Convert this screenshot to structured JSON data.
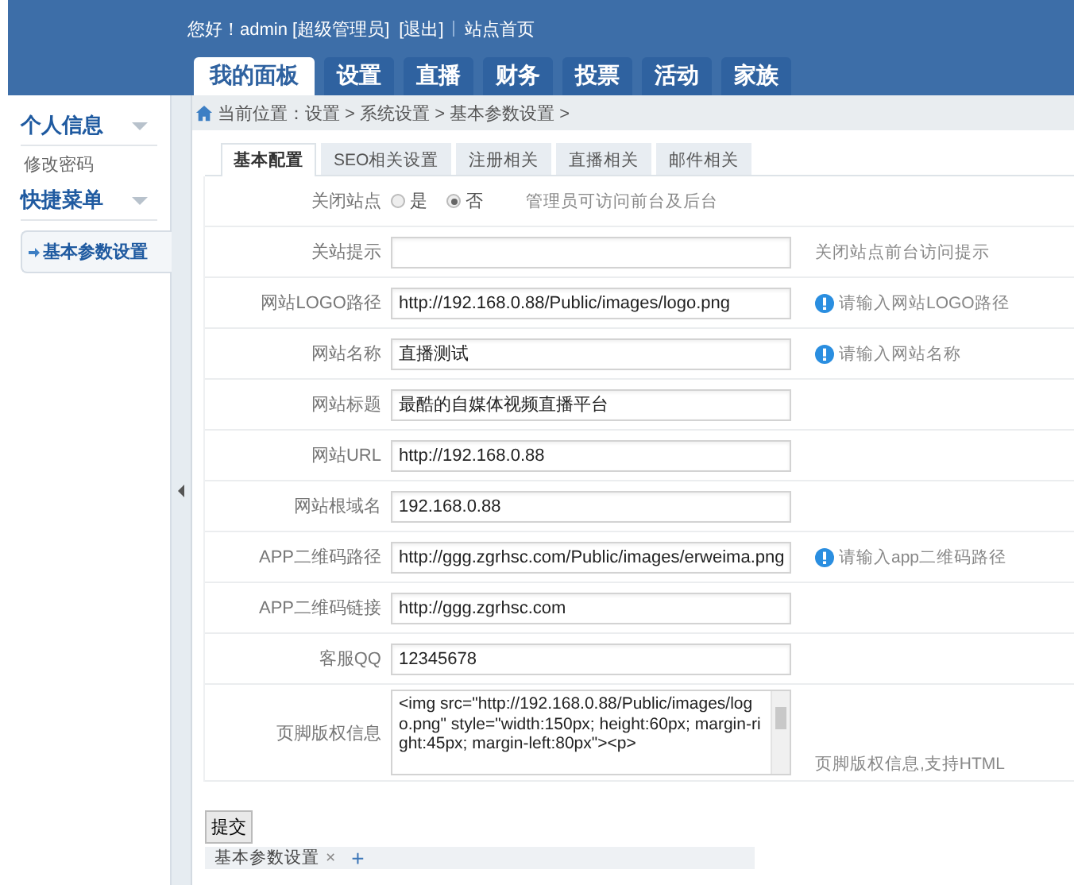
{
  "header": {
    "greeting": "您好！admin [超级管理员]",
    "links": [
      "[退出]",
      "站点首页"
    ]
  },
  "nav_tabs": [
    {
      "label": "我的面板",
      "selected": true
    },
    {
      "label": "设置",
      "selected": false
    },
    {
      "label": "直播",
      "selected": false
    },
    {
      "label": "财务",
      "selected": false
    },
    {
      "label": "投票",
      "selected": false
    },
    {
      "label": "活动",
      "selected": false
    },
    {
      "label": "家族",
      "selected": false
    }
  ],
  "sidebar": {
    "groups": [
      {
        "title": "个人信息",
        "items": [
          {
            "label": "修改密码",
            "selected": false
          }
        ]
      },
      {
        "title": "快捷菜单",
        "items": [
          {
            "label": "基本参数设置",
            "selected": true
          }
        ]
      }
    ]
  },
  "breadcrumb": "当前位置：设置 > 系统设置 > 基本参数设置 >",
  "tabs": [
    {
      "label": "基本配置",
      "selected": true
    },
    {
      "label": "SEO相关设置",
      "selected": false
    },
    {
      "label": "注册相关",
      "selected": false
    },
    {
      "label": "直播相关",
      "selected": false
    },
    {
      "label": "邮件相关",
      "selected": false
    }
  ],
  "form_rows": [
    {
      "kind": "radio",
      "label": "关闭站点",
      "options": [
        {
          "label": "是",
          "selected": false
        },
        {
          "label": "否",
          "selected": true
        }
      ],
      "hint": "管理员可访问前台及后台",
      "hint_icon": false
    },
    {
      "kind": "input",
      "label": "关站提示",
      "value": "",
      "hint": "关闭站点前台访问提示",
      "hint_icon": false
    },
    {
      "kind": "input",
      "label": "网站LOGO路径",
      "value": "http://192.168.0.88/Public/images/logo.png",
      "hint": "请输入网站LOGO路径",
      "hint_icon": true
    },
    {
      "kind": "input",
      "label": "网站名称",
      "value": "直播测试",
      "hint": "请输入网站名称",
      "hint_icon": true
    },
    {
      "kind": "input",
      "label": "网站标题",
      "value": "最酷的自媒体视频直播平台"
    },
    {
      "kind": "input",
      "label": "网站URL",
      "value": "http://192.168.0.88"
    },
    {
      "kind": "input",
      "label": "网站根域名",
      "value": "192.168.0.88"
    },
    {
      "kind": "input",
      "label": "APP二维码路径",
      "value": "http://ggg.zgrhsc.com/Public/images/erweima.png",
      "hint": "请输入app二维码路径",
      "hint_icon": true
    },
    {
      "kind": "input",
      "label": "APP二维码链接",
      "value": "http://ggg.zgrhsc.com"
    },
    {
      "kind": "input",
      "label": "客服QQ",
      "value": "12345678"
    },
    {
      "kind": "textarea",
      "label": "页脚版权信息",
      "value": "<img src=\"http://192.168.0.88/Public/images/logo.png\" style=\"width:150px; height:60px; margin-right:45px; margin-left:80px\"><p>",
      "hint": "页脚版权信息,支持HTML",
      "hint_icon": false
    }
  ],
  "submit": "提交",
  "bottom_tabs": [
    {
      "label": "基本参数设置",
      "close": "×"
    }
  ],
  "add_tab": "+"
}
